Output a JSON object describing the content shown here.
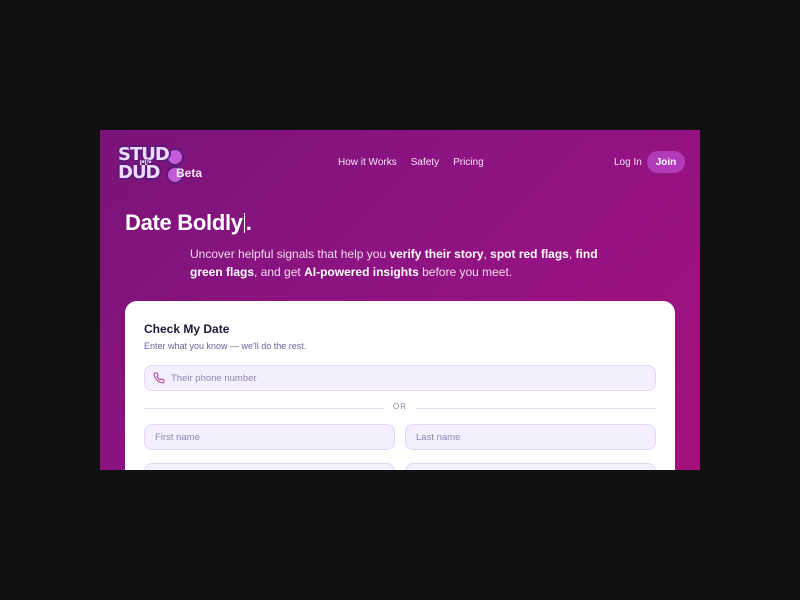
{
  "brand": {
    "logo_line1": "STUD",
    "logo_or": "OR",
    "logo_line2": "DUD",
    "badge": "Beta"
  },
  "nav": {
    "items": [
      "How it Works",
      "Safety",
      "Pricing"
    ],
    "login": "Log In",
    "join": "Join"
  },
  "hero": {
    "title": "Date Boldly",
    "title_end": ".",
    "subtitle": {
      "t1": "Uncover helpful signals that help you ",
      "b1": "verify their story",
      "t2": ", ",
      "b2": "spot red flags",
      "t3": ", ",
      "b3": "find green flags",
      "t4": ", and get ",
      "b4": "AI-powered insights",
      "t5": " before you meet."
    }
  },
  "form": {
    "title": "Check My Date",
    "subtitle": "Enter what you know — we'll do the rest.",
    "phone_placeholder": "Their phone number",
    "or_label": "OR",
    "first_name_placeholder": "First name",
    "last_name_placeholder": "Last name"
  },
  "colors": {
    "bg_start": "#7a1478",
    "bg_end": "#a4117c",
    "accent": "#b03ab8",
    "field_bg": "#f3efff"
  },
  "icons": {
    "phone": "phone-icon"
  }
}
